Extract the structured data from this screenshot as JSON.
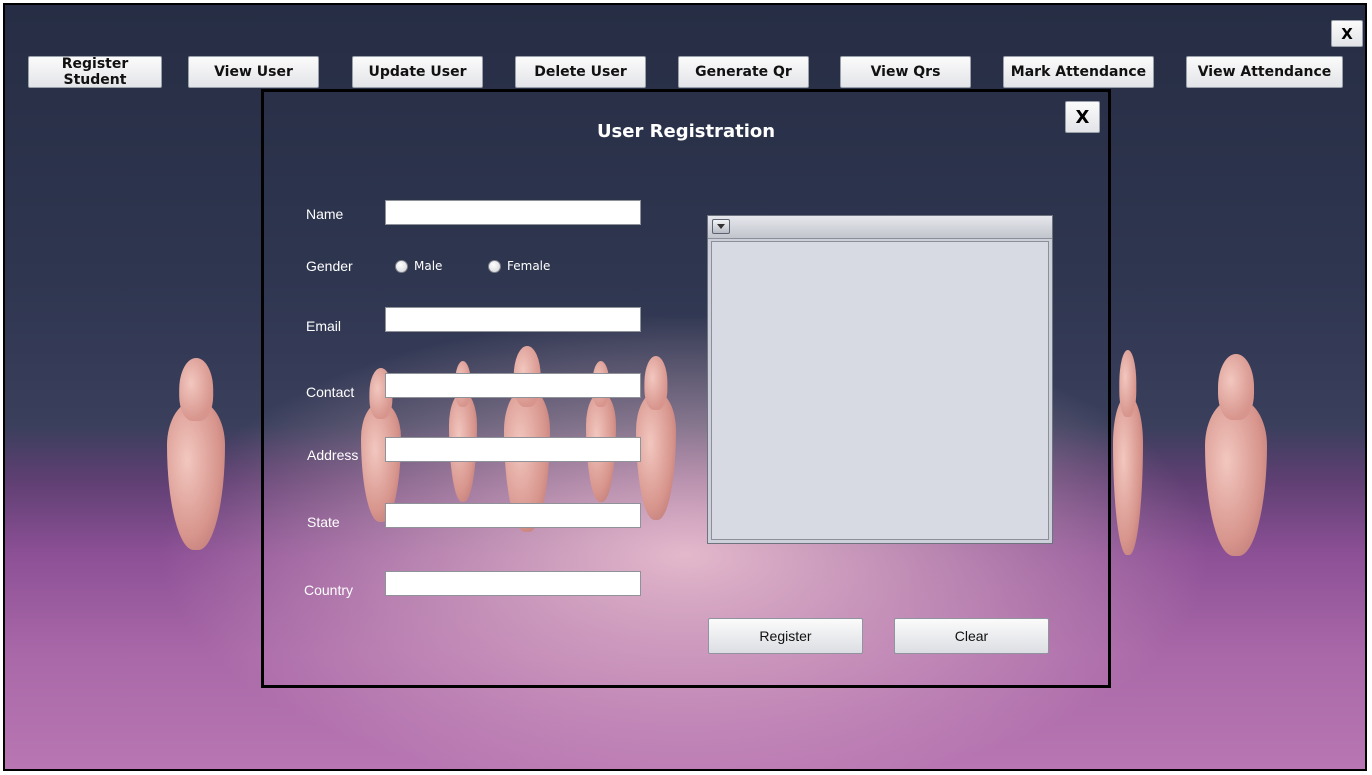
{
  "toolbar": {
    "buttons": [
      {
        "label": "Register Student"
      },
      {
        "label": "View User"
      },
      {
        "label": "Update User"
      },
      {
        "label": "Delete User"
      },
      {
        "label": "Generate Qr"
      },
      {
        "label": "View Qrs"
      },
      {
        "label": "Mark Attendance"
      },
      {
        "label": "View Attendance"
      }
    ],
    "close_label": "X"
  },
  "dialog": {
    "title": "User Registration",
    "close_label": "X",
    "fields": {
      "name": {
        "label": "Name",
        "value": ""
      },
      "gender": {
        "label": "Gender",
        "options": [
          "Male",
          "Female"
        ],
        "selected": ""
      },
      "email": {
        "label": "Email",
        "value": ""
      },
      "contact": {
        "label": "Contact",
        "value": ""
      },
      "address": {
        "label": "Address",
        "value": ""
      },
      "state": {
        "label": "State",
        "value": ""
      },
      "country": {
        "label": "Country",
        "value": ""
      }
    },
    "register_label": "Register",
    "clear_label": "Clear"
  },
  "icons": {
    "panel_menu": "dropdown-arrow-icon"
  }
}
